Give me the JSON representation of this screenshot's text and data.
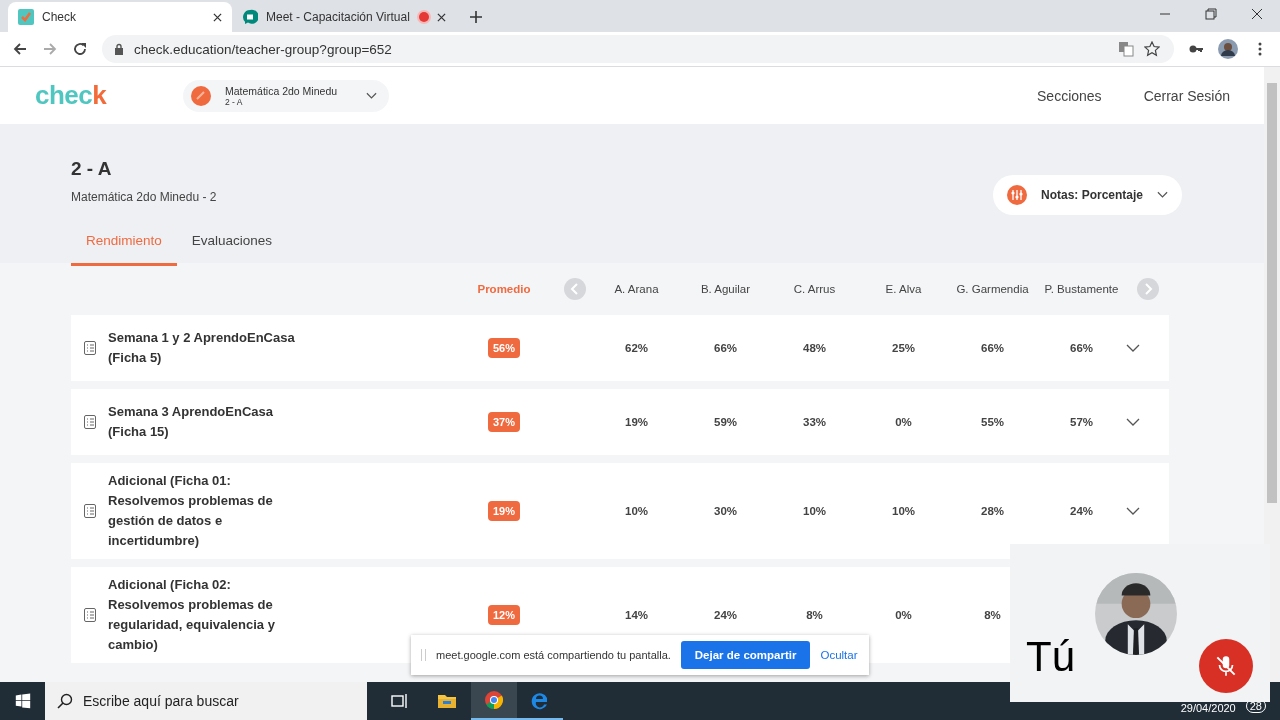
{
  "browser": {
    "tabs": [
      {
        "title": "Check",
        "selected": true,
        "recording": false
      },
      {
        "title": "Meet - Capacitación Virtual",
        "selected": false,
        "recording": true
      }
    ],
    "url": "check.education/teacher-group?group=652"
  },
  "header": {
    "logo": "check",
    "course": {
      "title": "Matemática 2do Minedu",
      "subtitle": "2 - A"
    },
    "nav": [
      "Secciones",
      "Cerrar Sesión"
    ]
  },
  "group": {
    "title": "2 - A",
    "subtitle": "Matemática 2do Minedu - 2",
    "grades_select": "Notas: Porcentaje"
  },
  "tabs": [
    {
      "label": "Rendimiento",
      "selected": true
    },
    {
      "label": "Evaluaciones",
      "selected": false
    }
  ],
  "table": {
    "average_label": "Promedio",
    "students": [
      "A. Arana",
      "B. Aguilar",
      "C. Arrus",
      "E. Alva",
      "G. Garmendia",
      "P. Bustamente"
    ],
    "rows": [
      {
        "name": "Semana 1 y 2 AprendoEnCasa (Ficha 5)",
        "average": "56%",
        "scores": [
          "62%",
          "66%",
          "48%",
          "25%",
          "66%",
          "66%"
        ]
      },
      {
        "name": "Semana 3 AprendoEnCasa (Ficha 15)",
        "average": "37%",
        "scores": [
          "19%",
          "59%",
          "33%",
          "0%",
          "55%",
          "57%"
        ]
      },
      {
        "name": "Adicional (Ficha 01: Resolvemos problemas de gestión de datos e incertidumbre)",
        "average": "19%",
        "scores": [
          "10%",
          "30%",
          "10%",
          "10%",
          "28%",
          "24%"
        ]
      },
      {
        "name": "Adicional (Ficha 02: Resolvemos problemas de regularidad, equivalencia y cambio)",
        "average": "12%",
        "scores": [
          "14%",
          "24%",
          "8%",
          "0%",
          "8%"
        ]
      }
    ]
  },
  "share_bar": {
    "message": "meet.google.com está compartiendo tu pantalla.",
    "stop_button": "Dejar de compartir",
    "hide_link": "Ocultar"
  },
  "meet_self_view": {
    "label": "Tú",
    "muted": true
  },
  "taskbar": {
    "search_placeholder": "Escribe aquí para buscar",
    "date": "29/04/2020",
    "notifications": "28"
  }
}
